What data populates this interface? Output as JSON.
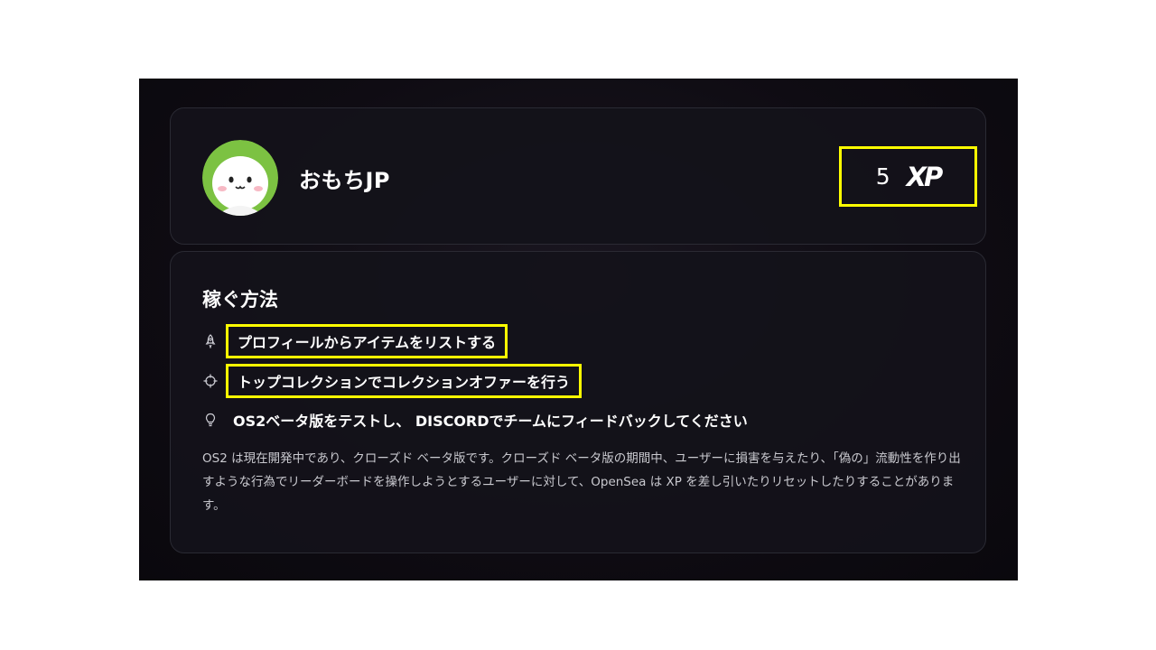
{
  "profile": {
    "username": "おもちJP",
    "xp_value": "5",
    "xp_label": "XP"
  },
  "earn": {
    "title": "稼ぐ方法",
    "tasks": [
      {
        "label": "プロフィールからアイテムをリストする",
        "icon": "rocket-icon"
      },
      {
        "label": "トップコレクションでコレクションオファーを行う",
        "icon": "crosshair-icon"
      },
      {
        "label": "OS2ベータ版をテストし、 DISCORDでチームにフィードバックしてください",
        "icon": "lightbulb-icon"
      }
    ],
    "disclaimer": "OS2 は現在開発中であり、クローズド ベータ版です。クローズド ベータ版の期間中、ユーザーに損害を与えたり、「偽の」流動性を作り出すような行為でリーダーボードを操作しようとするユーザーに対して、OpenSea は XP を差し引いたりリセットしたりすることがあります。"
  },
  "colors": {
    "highlight": "#ffff00",
    "avatar_ring": "#7cc242",
    "background": "#0f0c13"
  }
}
